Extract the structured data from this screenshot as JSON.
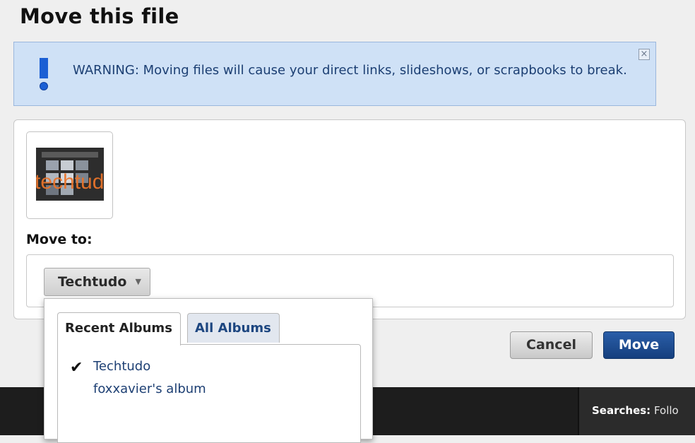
{
  "dialog": {
    "title": "Move this file"
  },
  "warning": {
    "text": "WARNING: Moving files will cause your direct links, slideshows, or scrapbooks to break.",
    "icon": "exclamation-icon",
    "close_icon": "close-icon",
    "close_label": "×",
    "colors": {
      "background": "#cfe1f6",
      "text": "#1c3f73",
      "icon": "#1b5fd4"
    }
  },
  "file": {
    "thumbnail_text": "techtudo"
  },
  "move_to": {
    "label": "Move to:",
    "selected_album": "Techtudo",
    "dropdown_caret": "▼"
  },
  "album_picker": {
    "tabs": [
      {
        "label": "Recent Albums",
        "active": true
      },
      {
        "label": "All Albums",
        "active": false
      }
    ],
    "albums": [
      {
        "name": "Techtudo",
        "selected": true
      },
      {
        "name": "foxxavier's album",
        "selected": false
      }
    ],
    "check_mark": "✔"
  },
  "buttons": {
    "cancel_label": "Cancel",
    "move_label": "Move",
    "colors": {
      "move_bg": "#1d4a8f",
      "cancel_bg": "#d8d8d8"
    }
  },
  "background_page": {
    "searches_label": "Searches:",
    "searches_value": "Follo"
  }
}
